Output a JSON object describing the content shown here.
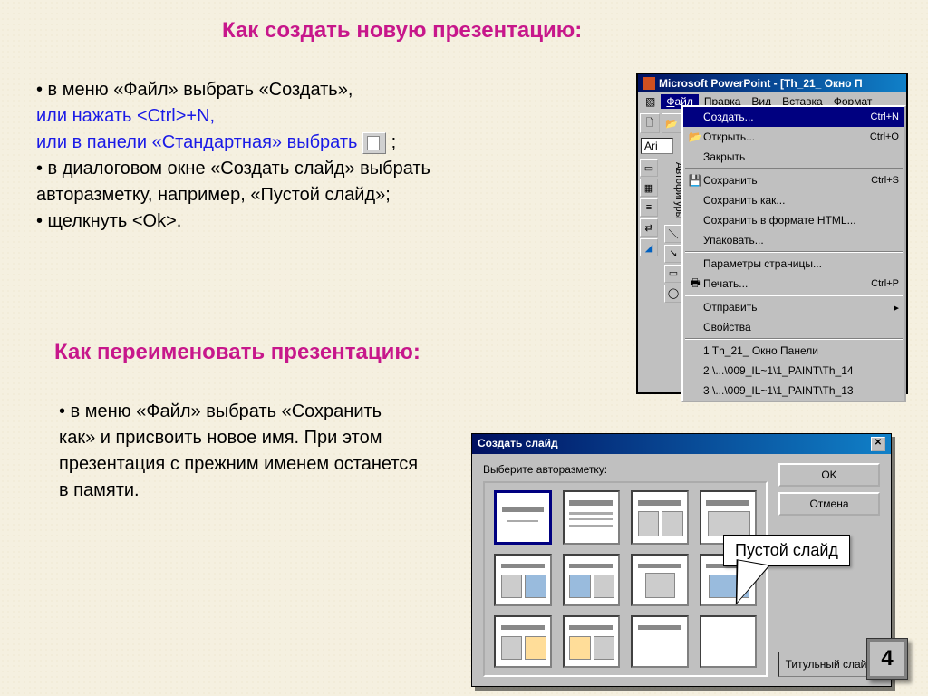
{
  "heading1": "Как создать новую  презентацию:",
  "heading2": "Как переименовать презентацию:",
  "block1": {
    "l1": "• в меню «Файл» выбрать «Создать»,",
    "l2a": "или нажать ",
    "l2b": "<Ctrl>+N",
    "l2c": ",",
    "l3a": "или  в панели «Стандартная» выбрать",
    "l3b": ";",
    "l4": "• в диалоговом окне «Создать слайд» выбрать",
    "l5": "авторазметку, например, «Пустой слайд»;",
    "l6": "• щелкнуть <Ok>."
  },
  "block2": "• в меню «Файл» выбрать «Сохранить как» и присвоить новое имя. При этом презентация с прежним именем останется в памяти.",
  "pp": {
    "title": "Microsoft PowerPoint - [Th_21_ Окно П",
    "menubar": [
      "Файл",
      "Правка",
      "Вид",
      "Вставка",
      "Формат"
    ],
    "menu": [
      {
        "ic": "",
        "lab": "Создать...",
        "sc": "Ctrl+N",
        "hl": true
      },
      {
        "ic": "📂",
        "lab": "Открыть...",
        "sc": "Ctrl+O"
      },
      {
        "ic": "",
        "lab": "Закрыть",
        "sc": ""
      },
      {
        "sep": true
      },
      {
        "ic": "💾",
        "lab": "Сохранить",
        "sc": "Ctrl+S"
      },
      {
        "ic": "",
        "lab": "Сохранить как...",
        "sc": ""
      },
      {
        "ic": "",
        "lab": "Сохранить в формате HTML...",
        "sc": ""
      },
      {
        "ic": "",
        "lab": "Упаковать...",
        "sc": ""
      },
      {
        "sep": true
      },
      {
        "ic": "",
        "lab": "Параметры страницы...",
        "sc": ""
      },
      {
        "ic": "🖶",
        "lab": "Печать...",
        "sc": "Ctrl+P"
      },
      {
        "sep": true
      },
      {
        "ic": "",
        "lab": "Отправить",
        "sc": "▸"
      },
      {
        "ic": "",
        "lab": "Свойства",
        "sc": ""
      },
      {
        "sep": true
      },
      {
        "ic": "",
        "lab": "1 Th_21_ Окно Панели",
        "sc": ""
      },
      {
        "ic": "",
        "lab": "2 \\...\\009_IL~1\\1_PAINT\\Th_14",
        "sc": ""
      },
      {
        "ic": "",
        "lab": "3 \\...\\009_IL~1\\1_PAINT\\Th_13",
        "sc": ""
      }
    ],
    "fontname": "Ari",
    "sidebar_label": "Автофигуры"
  },
  "dlg": {
    "title": "Создать слайд",
    "prompt": "Выберите авторазметку:",
    "ok": "OK",
    "cancel": "Отмена",
    "layout_name": "Титульный слайд"
  },
  "callout": "Пустой слайд",
  "page": "4"
}
